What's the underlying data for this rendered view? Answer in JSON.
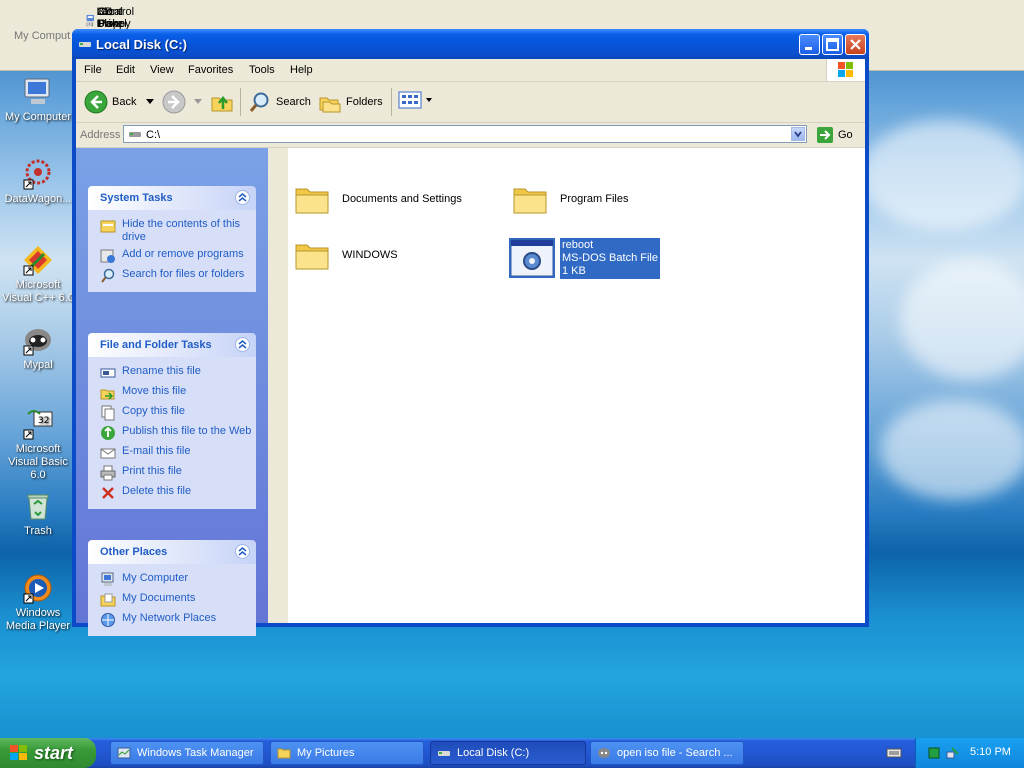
{
  "top_links": [
    "3½ Floppy (A:)",
    "Local Disk (C:)",
    "CD Drive (D:)",
    "Control Panel"
  ],
  "top_partial_label": "My Comput",
  "desktop_icons": [
    {
      "label": "My Computer",
      "icon": "my-computer-icon"
    },
    {
      "label": "DataWagon...",
      "icon": "datawagon-icon"
    },
    {
      "label": "Microsoft Visual C++ 6.0",
      "icon": "visual-cpp-icon"
    },
    {
      "label": "Mypal",
      "icon": "mypal-icon"
    },
    {
      "label": "Microsoft Visual Basic 6.0",
      "icon": "visual-basic-icon"
    },
    {
      "label": "Trash",
      "icon": "recycle-bin-icon"
    },
    {
      "label": "Windows Media Player",
      "icon": "media-player-icon"
    }
  ],
  "window": {
    "title": "Local Disk (C:)",
    "menu": [
      "File",
      "Edit",
      "View",
      "Favorites",
      "Tools",
      "Help"
    ],
    "toolbar": {
      "back": "Back",
      "search": "Search",
      "folders": "Folders"
    },
    "address_label": "Address",
    "address_value": "C:\\",
    "go_label": "Go",
    "system_tasks": {
      "title": "System Tasks",
      "items": [
        "Hide the contents of this drive",
        "Add or remove programs",
        "Search for files or folders"
      ]
    },
    "file_folder_tasks": {
      "title": "File and Folder Tasks",
      "items": [
        "Rename this file",
        "Move this file",
        "Copy this file",
        "Publish this file to the Web",
        "E-mail this file",
        "Print this file",
        "Delete this file"
      ]
    },
    "other_places": {
      "title": "Other Places",
      "items": [
        "My Computer",
        "My Documents",
        "My Network Places"
      ]
    },
    "files": [
      {
        "name": "Documents and Settings",
        "type": "folder"
      },
      {
        "name": "Program Files",
        "type": "folder"
      },
      {
        "name": "WINDOWS",
        "type": "folder"
      },
      {
        "name": "reboot",
        "type": "MS-DOS Batch File",
        "size": "1 KB",
        "selected": true
      }
    ]
  },
  "taskbar": {
    "start_label": "start",
    "tasks": [
      "Windows Task Manager",
      "My Pictures",
      "Local Disk (C:)",
      "open iso file - Search ..."
    ],
    "active_task": "Local Disk (C:)",
    "clock": "5:10 PM"
  },
  "colors": {
    "accent": "#0a5fe8",
    "task_link": "#215dc6",
    "selection": "#316ac5",
    "start_green": "#389a38"
  }
}
